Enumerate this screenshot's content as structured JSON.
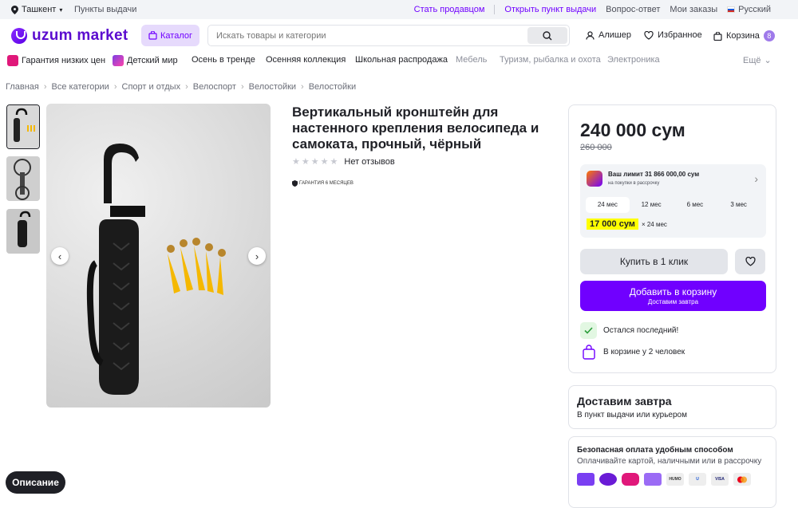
{
  "topbar": {
    "city": "Ташкент",
    "pickup_points": "Пункты выдачи",
    "links": [
      "Стать продавцом",
      "Открыть пункт выдачи",
      "Вопрос-ответ",
      "Мои заказы"
    ],
    "language": "Русский"
  },
  "header": {
    "logo": "uzum market",
    "catalog_label": "Каталог",
    "search_placeholder": "Искать товары и категории",
    "user_name": "Алишер",
    "favorites_label": "Избранное",
    "cart_label": "Корзина",
    "cart_count": "8"
  },
  "categories": [
    "Гарантия низких цен",
    "Детский мир",
    "Осень в тренде",
    "Осенняя коллекция",
    "Школьная распродажа",
    "Мебель",
    "Туризм, рыбалка и охота",
    "Электроника"
  ],
  "more_label": "Ещё",
  "breadcrumbs": [
    "Главная",
    "Все категории",
    "Спорт и отдых",
    "Велоспорт",
    "Велостойки",
    "Велостойки"
  ],
  "product": {
    "title": "Вертикальный кронштейн для настенного крепления велосипеда и самоката, прочный, чёрный",
    "reviews": "Нет отзывов",
    "warranty": "Гарантия 6 месяцев",
    "rating": 0
  },
  "pricing": {
    "price": "240 000 сум",
    "old_price": "260 000",
    "limit_title": "Ваш лимит 31 866 000,00 сум",
    "limit_sub": "на покупки в рассрочку",
    "months": [
      "24 мес",
      "12 мес",
      "6 мес",
      "3 мес"
    ],
    "selected_month": "24 мес",
    "monthly_amount": "17 000 сум",
    "monthly_term": "× 24 мес",
    "buy_one_click": "Купить в 1 клик",
    "add_to_cart": "Добавить в корзину",
    "add_to_cart_sub": "Доставим завтра",
    "status_last": "Остался последний!",
    "status_in_cart": "В корзине у 2 человек"
  },
  "delivery": {
    "title": "Доставим завтра",
    "subtitle": "В пункт выдачи или курьером"
  },
  "payment": {
    "title": "Безопасная оплата удобным способом",
    "subtitle": "Оплачивайте картой, наличными или в рассрочку",
    "methods": [
      "uzum card",
      "uzum nasiya",
      "uzum",
      "wallet",
      "HUMO",
      "Uzcard",
      "VISA",
      "Mastercard"
    ]
  },
  "description_button": "Описание",
  "colors": {
    "accent": "#7000ff",
    "highlight": "#ffff00"
  }
}
